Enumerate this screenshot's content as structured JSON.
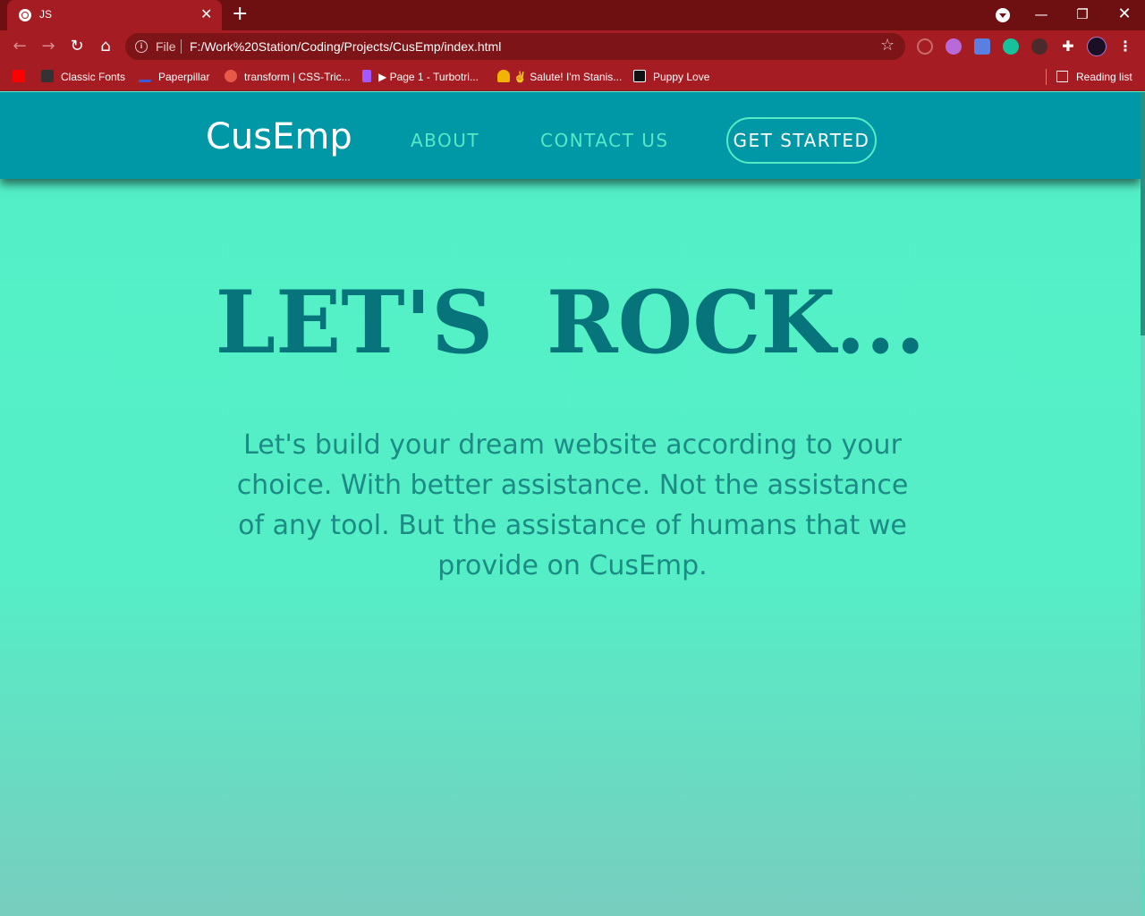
{
  "browser": {
    "tab_title": "JS",
    "tab_close": "✕",
    "new_tab": "+",
    "url_scheme_label": "File",
    "url": "F:/Work%20Station/Coding/Projects/CusEmp/index.html",
    "bookmarks": [
      {
        "label": "",
        "icon": "youtube-icon"
      },
      {
        "label": "Classic Fonts",
        "icon": "sg-icon"
      },
      {
        "label": "Paperpillar",
        "icon": "paperpillar-icon"
      },
      {
        "label": "transform | CSS-Tric...",
        "icon": "css-tricks-icon"
      },
      {
        "label": "▶ Page 1 - Turbotri...",
        "icon": "figma-icon"
      },
      {
        "label": "✌ Salute! I'm Stanis...",
        "icon": "horseshoe-icon"
      },
      {
        "label": "Puppy Love",
        "icon": "p-icon"
      }
    ],
    "reading_list": "Reading list"
  },
  "site": {
    "logo": "CusEmp",
    "nav": {
      "about": "ABOUT",
      "contact": "CONTACT US",
      "cta": "GET STARTED"
    },
    "hero": {
      "title": "LET'S ROCK...",
      "text": "Let's build your dream website according to your choice. With better assistance. Not the assistance of any tool. But the assistance of humans that we provide on CusEmp."
    }
  },
  "colors": {
    "chrome_dark": "#6e1011",
    "chrome": "#a51c22",
    "navbar": "#0098a6",
    "page_bg": "#53f0c7",
    "accent_mint": "#56e9c5",
    "title": "#07737a",
    "body_text": "#1d8a86"
  }
}
